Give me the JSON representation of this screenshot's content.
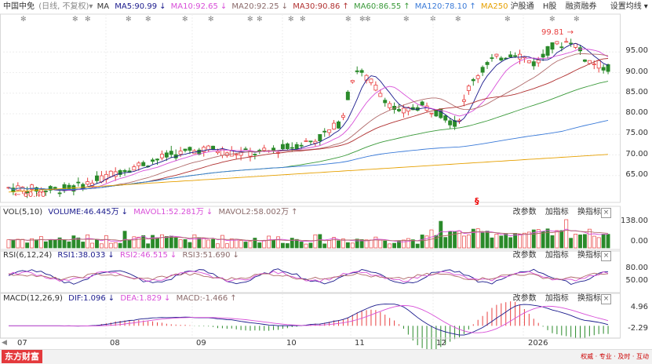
{
  "legend": {
    "title": "中国中免",
    "mode": "(日线, 不复权)",
    "mode_arrow": "▾",
    "ma_label": "MA",
    "ma5": "MA5:90.99",
    "ma5_arrow": "↓",
    "ma10": "MA10:92.65",
    "ma10_arrow": "↓",
    "ma20": "MA20:92.25",
    "ma20_arrow": "↓",
    "ma30": "MA30:90.86",
    "ma30_arrow": "↑",
    "ma60": "MA60:86.55",
    "ma60_arrow": "↑",
    "ma120": "MA120:78.10",
    "ma120_arrow": "↑",
    "ma250": "MA250",
    "hgt": "沪股通",
    "hshare": "H股",
    "margin": "融资融券",
    "settings": "设置均线",
    "settings_arrow": "▾"
  },
  "colors": {
    "ma5": "#1a1a8c",
    "ma10": "#d84fd8",
    "ma20": "#b06a6a",
    "ma30": "#b03030",
    "ma60": "#3a9a3a",
    "ma120": "#3a7ad8",
    "ma250": "#e6a000",
    "up": "#e84040",
    "down": "#2a8a2a"
  },
  "price_axis": [
    "95.00",
    "90.00",
    "85.00",
    "80.00",
    "75.00",
    "70.00",
    "65.00"
  ],
  "annotations": {
    "high": "99.81",
    "low": "60.40",
    "s_marker": "§"
  },
  "vol_panel": {
    "label": "VOL(5,10)",
    "volume": "VOLUME:46.445万",
    "volume_arrow": "↓",
    "mavol1": "MAVOL1:52.281万",
    "mavol1_arrow": "↓",
    "mavol2": "MAVOL2:58.002万",
    "mavol2_arrow": "↑",
    "axis": [
      "138.00",
      "0.00"
    ],
    "btn_change": "改参数",
    "btn_add": "加指标",
    "btn_switch": "换指标",
    "close": "×"
  },
  "rsi_panel": {
    "label": "RSI(6,12,24)",
    "rsi1": "RSI1:38.033",
    "rsi1_arrow": "↓",
    "rsi2": "RSI2:46.515",
    "rsi2_arrow": "↓",
    "rsi3": "RSI3:51.690",
    "rsi3_arrow": "↓",
    "axis": [
      "80.00",
      "50.00"
    ],
    "btn_change": "改参数",
    "btn_add": "加指标",
    "btn_switch": "换指标",
    "close": "×"
  },
  "macd_panel": {
    "label": "MACD(12,26,9)",
    "dif": "DIF:1.096",
    "dif_arrow": "↓",
    "dea": "DEA:1.829",
    "dea_arrow": "↓",
    "macd": "MACD:-1.466",
    "macd_arrow": "↑",
    "axis": [
      "4.96",
      "-2.29"
    ],
    "btn_change": "改参数",
    "btn_add": "加指标",
    "btn_switch": "换指标",
    "close": "×"
  },
  "x_axis": [
    "07",
    "08",
    "09",
    "10",
    "11",
    "12",
    "2026"
  ],
  "footer": {
    "logo": "东方财富",
    "slogan": "权威 · 专业 · 及时 · 互动"
  }
}
